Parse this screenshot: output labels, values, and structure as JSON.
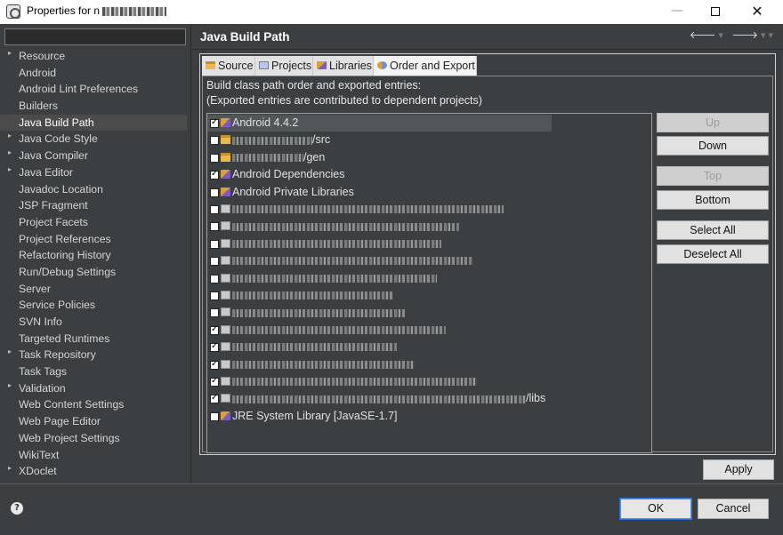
{
  "window": {
    "title_prefix": "Properties for n",
    "minimize": "—",
    "close": "✕"
  },
  "sidebar": {
    "filter_value": "",
    "items": [
      {
        "label": "Resource",
        "expandable": true
      },
      {
        "label": "Android",
        "expandable": false
      },
      {
        "label": "Android Lint Preferences",
        "expandable": false
      },
      {
        "label": "Builders",
        "expandable": false
      },
      {
        "label": "Java Build Path",
        "expandable": false,
        "selected": true
      },
      {
        "label": "Java Code Style",
        "expandable": true
      },
      {
        "label": "Java Compiler",
        "expandable": true
      },
      {
        "label": "Java Editor",
        "expandable": true
      },
      {
        "label": "Javadoc Location",
        "expandable": false
      },
      {
        "label": "JSP Fragment",
        "expandable": false
      },
      {
        "label": "Project Facets",
        "expandable": false
      },
      {
        "label": "Project References",
        "expandable": false
      },
      {
        "label": "Refactoring History",
        "expandable": false
      },
      {
        "label": "Run/Debug Settings",
        "expandable": false
      },
      {
        "label": "Server",
        "expandable": false
      },
      {
        "label": "Service Policies",
        "expandable": false
      },
      {
        "label": "SVN Info",
        "expandable": false
      },
      {
        "label": "Targeted Runtimes",
        "expandable": false
      },
      {
        "label": "Task Repository",
        "expandable": true
      },
      {
        "label": "Task Tags",
        "expandable": false
      },
      {
        "label": "Validation",
        "expandable": true
      },
      {
        "label": "Web Content Settings",
        "expandable": false
      },
      {
        "label": "Web Page Editor",
        "expandable": false
      },
      {
        "label": "Web Project Settings",
        "expandable": false
      },
      {
        "label": "WikiText",
        "expandable": false
      },
      {
        "label": "XDoclet",
        "expandable": true
      }
    ]
  },
  "main": {
    "title": "Java Build Path",
    "nav_back": "🡐",
    "nav_forward": "🡒",
    "tabs": [
      {
        "label": "Source",
        "icon": "source-folder-icon"
      },
      {
        "label": "Projects",
        "icon": "projects-icon"
      },
      {
        "label": "Libraries",
        "icon": "libraries-icon"
      },
      {
        "label": "Order and Export",
        "icon": "order-export-icon",
        "active": true
      }
    ],
    "description_line1": "Build class path order and exported entries:",
    "description_line2": "(Exported entries are contributed to dependent projects)",
    "entries": [
      {
        "label": "Android 4.4.2",
        "checked": true,
        "icon": "library-icon",
        "selected": true
      },
      {
        "label": "/src",
        "checked": false,
        "icon": "source-folder-icon",
        "redacted": true
      },
      {
        "label": "/gen",
        "checked": false,
        "icon": "source-folder-icon",
        "redacted": true
      },
      {
        "label": "Android Dependencies",
        "checked": true,
        "icon": "library-icon"
      },
      {
        "label": "Android Private Libraries",
        "checked": false,
        "icon": "library-icon"
      },
      {
        "label": "",
        "checked": false,
        "icon": "jar-icon",
        "redacted": true
      },
      {
        "label": "",
        "checked": false,
        "icon": "jar-icon",
        "redacted": true
      },
      {
        "label": "",
        "checked": false,
        "icon": "jar-icon",
        "redacted": true
      },
      {
        "label": "",
        "checked": false,
        "icon": "jar-icon",
        "redacted": true
      },
      {
        "label": "",
        "checked": false,
        "icon": "jar-icon",
        "redacted": true
      },
      {
        "label": "",
        "checked": false,
        "icon": "jar-icon",
        "redacted": true
      },
      {
        "label": "",
        "checked": false,
        "icon": "jar-icon",
        "redacted": true
      },
      {
        "label": "",
        "checked": true,
        "icon": "jar-icon",
        "redacted": true
      },
      {
        "label": "",
        "checked": true,
        "icon": "jar-icon",
        "redacted": true
      },
      {
        "label": "",
        "checked": true,
        "icon": "jar-icon",
        "redacted": true
      },
      {
        "label": "",
        "checked": true,
        "icon": "jar-icon",
        "redacted": true
      },
      {
        "label": "/libs",
        "checked": true,
        "icon": "jar-icon",
        "redacted": true
      },
      {
        "label": "JRE System Library [JavaSE-1.7]",
        "checked": false,
        "icon": "library-icon"
      }
    ],
    "buttons": {
      "up": "Up",
      "down": "Down",
      "top": "Top",
      "bottom": "Bottom",
      "select_all": "Select All",
      "deselect_all": "Deselect All",
      "apply": "Apply"
    }
  },
  "footer": {
    "help": "?",
    "ok": "OK",
    "cancel": "Cancel"
  }
}
